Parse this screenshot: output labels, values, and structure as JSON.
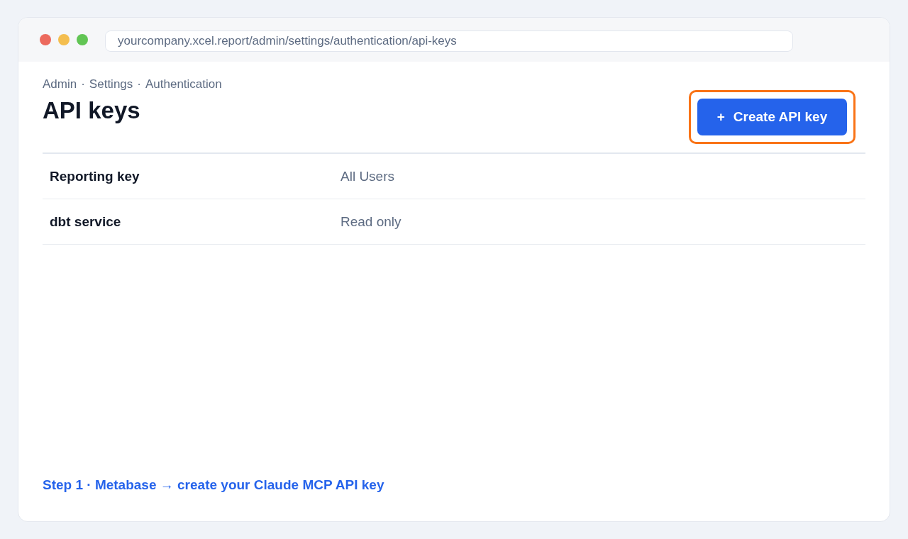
{
  "browser": {
    "url": "yourcompany.xcel.report/admin/settings/authentication/api-keys"
  },
  "breadcrumb": [
    "Admin",
    "Settings",
    "Authentication"
  ],
  "breadcrumb_separator": "·",
  "title": "API keys",
  "create_button": {
    "icon": "+",
    "label": "Create API key",
    "highlighted": true
  },
  "api_keys": [
    {
      "name": "Reporting key",
      "scope": "All Users"
    },
    {
      "name": "dbt service",
      "scope": "Read only"
    }
  ],
  "caption": "Step 1 · Metabase → create your Claude MCP API key"
}
